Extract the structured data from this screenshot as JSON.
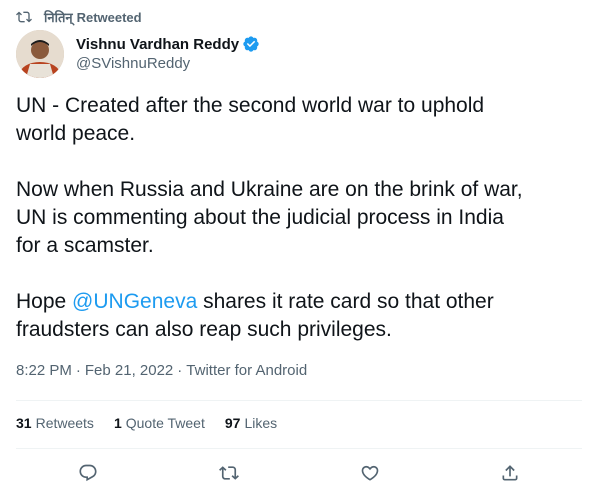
{
  "retweet": {
    "name": "नितिन्",
    "suffix": "Retweeted"
  },
  "author": {
    "display_name": "Vishnu Vardhan Reddy",
    "handle": "@SVishnuReddy",
    "verified": true
  },
  "tweet": {
    "line1": "UN - Created after the second world war to uphold",
    "line2": "world peace.",
    "line3": "Now when Russia and Ukraine are on the brink of war,",
    "line4": "UN is commenting about the judicial process in India",
    "line5": "for a scamster.",
    "line6_pre": "Hope ",
    "line6_mention": "@UNGeneva",
    "line6_post": " shares it rate card so that other",
    "line7": "fraudsters can also reap such privileges."
  },
  "meta": {
    "time": "8:22 PM",
    "date": "Feb 21, 2022",
    "source": "Twitter for Android",
    "sep": "·"
  },
  "stats": {
    "retweets_count": "31",
    "retweets_label": "Retweets",
    "quotes_count": "1",
    "quotes_label": "Quote Tweet",
    "likes_count": "97",
    "likes_label": "Likes"
  },
  "colors": {
    "accent": "#1d9bf0",
    "muted": "#536471",
    "text": "#0f1419",
    "divider": "#eff3f4"
  },
  "icons": [
    "retweet-icon",
    "verified-icon",
    "reply-icon",
    "retweet-icon",
    "like-icon",
    "share-icon"
  ]
}
